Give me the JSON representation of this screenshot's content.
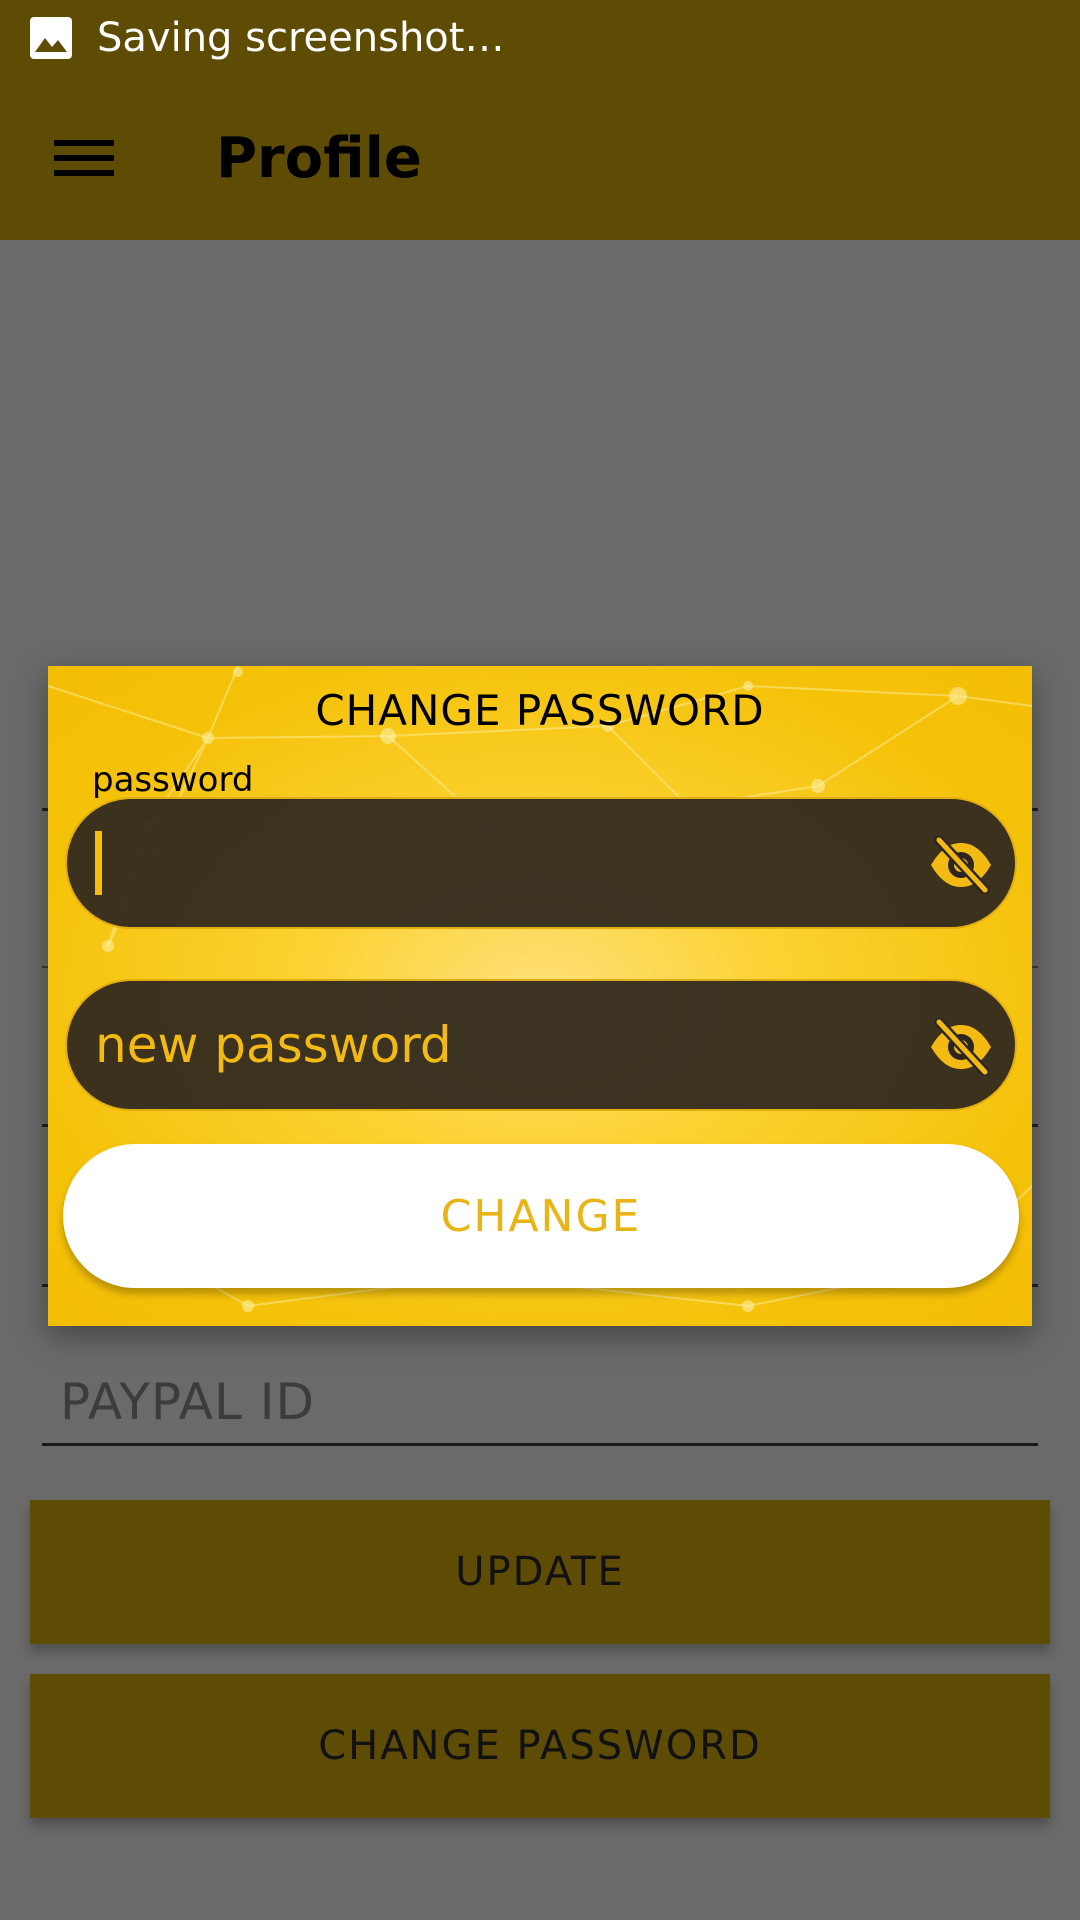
{
  "status_bar": {
    "notification_icon": "image-icon",
    "text": "Saving screenshot…"
  },
  "app_bar": {
    "menu_icon": "hamburger-menu-icon",
    "title": "Profile"
  },
  "form": {
    "paypal_placeholder": "PAYPAL ID",
    "update_label": "UPDATE",
    "change_password_label": "CHANGE PASSWORD"
  },
  "dialog": {
    "title": "CHANGE PASSWORD",
    "password_label": "password",
    "password_value": "",
    "new_password_placeholder": "new password",
    "visibility_icon": "eye-off-icon",
    "change_label": "CHANGE"
  },
  "colors": {
    "app_bar": "#5e4c05",
    "scrim_background": "#6a6a6a",
    "dialog_accent": "#f5c20a",
    "input_fill": "#2d261e",
    "accent_text": "#f2ba12"
  }
}
